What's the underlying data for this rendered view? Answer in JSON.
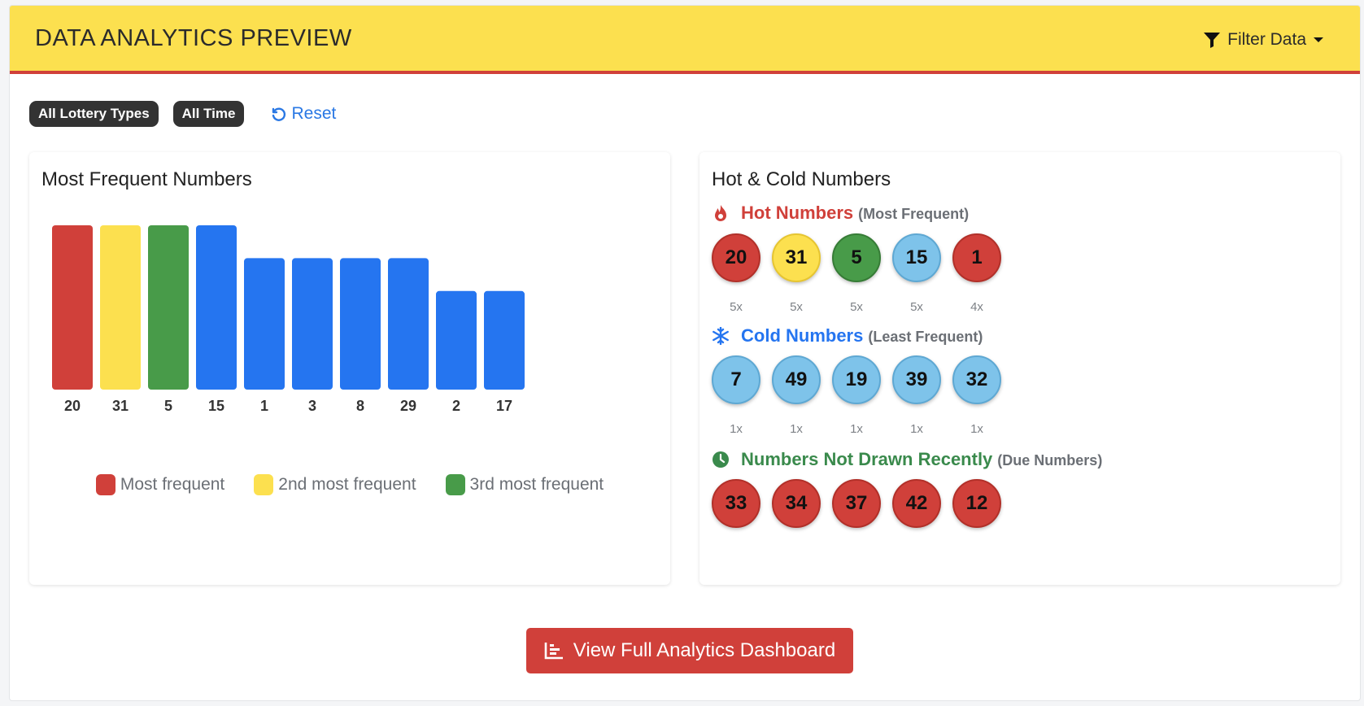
{
  "header": {
    "title": "DATA ANALYTICS PREVIEW",
    "filter_label": "Filter Data"
  },
  "filters": {
    "badges": [
      "All Lottery Types",
      "All Time"
    ],
    "reset_label": "Reset"
  },
  "left_panel": {
    "title": "Most Frequent Numbers"
  },
  "chart_data": {
    "type": "bar",
    "categories": [
      "20",
      "31",
      "5",
      "15",
      "1",
      "3",
      "8",
      "29",
      "2",
      "17"
    ],
    "values": [
      5,
      5,
      5,
      5,
      4,
      4,
      4,
      4,
      3,
      3
    ],
    "bar_colors": [
      "#d0403a",
      "#fce04f",
      "#489b49",
      "#2575f0",
      "#2575f0",
      "#2575f0",
      "#2575f0",
      "#2575f0",
      "#2575f0",
      "#2575f0"
    ],
    "legend": [
      {
        "label": "Most frequent",
        "color": "#d0403a"
      },
      {
        "label": "2nd most frequent",
        "color": "#fce04f"
      },
      {
        "label": "3rd most frequent",
        "color": "#489b49"
      }
    ],
    "legend_position": "bottom",
    "grid": false
  },
  "right_panel": {
    "title": "Hot & Cold Numbers",
    "hot": {
      "label": "Hot Numbers",
      "sub": "(Most Frequent)",
      "color": "#d0403a",
      "icon": "fire-icon",
      "balls": [
        {
          "n": "20",
          "c": "5x",
          "style": "red"
        },
        {
          "n": "31",
          "c": "5x",
          "style": "yellow"
        },
        {
          "n": "5",
          "c": "5x",
          "style": "green"
        },
        {
          "n": "15",
          "c": "5x",
          "style": "blue"
        },
        {
          "n": "1",
          "c": "4x",
          "style": "red"
        }
      ]
    },
    "cold": {
      "label": "Cold Numbers",
      "sub": "(Least Frequent)",
      "color": "#2575f0",
      "icon": "snowflake-icon",
      "balls": [
        {
          "n": "7",
          "c": "1x",
          "style": "blue"
        },
        {
          "n": "49",
          "c": "1x",
          "style": "blue"
        },
        {
          "n": "19",
          "c": "1x",
          "style": "blue"
        },
        {
          "n": "39",
          "c": "1x",
          "style": "blue"
        },
        {
          "n": "32",
          "c": "1x",
          "style": "blue"
        }
      ]
    },
    "due": {
      "label": "Numbers Not Drawn Recently",
      "sub": "(Due Numbers)",
      "color": "#3a8a4c",
      "icon": "clock-icon",
      "balls": [
        {
          "n": "33",
          "style": "red"
        },
        {
          "n": "34",
          "style": "red"
        },
        {
          "n": "37",
          "style": "red"
        },
        {
          "n": "42",
          "style": "red"
        },
        {
          "n": "12",
          "style": "red"
        }
      ]
    }
  },
  "cta": {
    "label": "View Full Analytics Dashboard",
    "icon": "chart-bar-icon"
  }
}
